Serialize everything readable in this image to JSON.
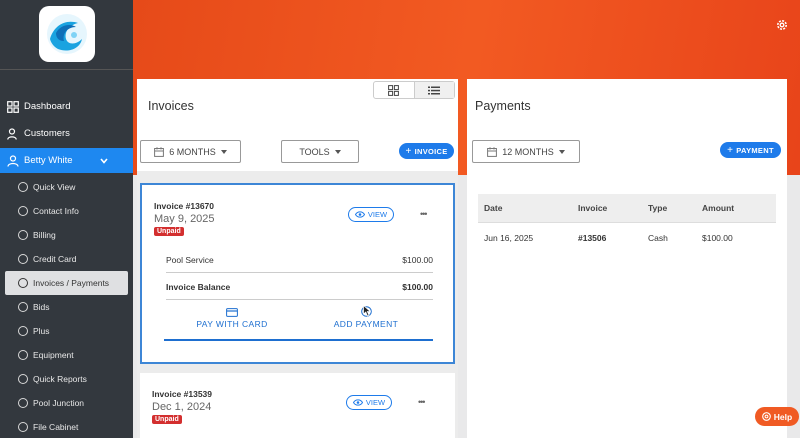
{
  "brand": {
    "logo_alt": "Sirens-Splash logo"
  },
  "sidebar": {
    "top_items": [
      {
        "label": "Dashboard",
        "icon": "dashboard-icon"
      },
      {
        "label": "Customers",
        "icon": "users-icon"
      }
    ],
    "customer": {
      "label": "Betty White",
      "icon": "person-icon"
    },
    "sub_items": [
      {
        "label": "Quick View"
      },
      {
        "label": "Contact Info"
      },
      {
        "label": "Billing"
      },
      {
        "label": "Credit Card"
      },
      {
        "label": "Invoices / Payments"
      },
      {
        "label": "Bids"
      },
      {
        "label": "Plus"
      },
      {
        "label": "Equipment"
      },
      {
        "label": "Quick Reports"
      },
      {
        "label": "Pool Junction"
      },
      {
        "label": "File Cabinet"
      }
    ]
  },
  "invoices": {
    "title": "Invoices",
    "filter_label": "6 MONTHS",
    "tools_label": "TOOLS",
    "add_label": "INVOICE",
    "items": [
      {
        "number": "Invoice #13670",
        "date": "May 9, 2025",
        "status": "Unpaid",
        "view_label": "VIEW",
        "lines": [
          {
            "label": "Pool Service",
            "amount": "$100.00"
          },
          {
            "label": "Invoice Balance",
            "amount": "$100.00"
          }
        ],
        "pay_card_label": "PAY WITH CARD",
        "add_payment_label": "ADD PAYMENT"
      },
      {
        "number": "Invoice #13539",
        "date": "Dec 1, 2024",
        "status": "Unpaid",
        "view_label": "VIEW"
      }
    ]
  },
  "payments": {
    "title": "Payments",
    "filter_label": "12 MONTHS",
    "add_label": "PAYMENT",
    "columns": [
      "Date",
      "Invoice",
      "Type",
      "Amount"
    ],
    "rows": [
      {
        "date": "Jun 16, 2025",
        "invoice": "#13506",
        "type": "Cash",
        "amount": "$100.00"
      }
    ]
  },
  "help_label": "Help",
  "colors": {
    "accent": "#1e7bea",
    "header": "#f25a22",
    "sidebar": "#33383e",
    "unpaid": "#d32f2f"
  }
}
